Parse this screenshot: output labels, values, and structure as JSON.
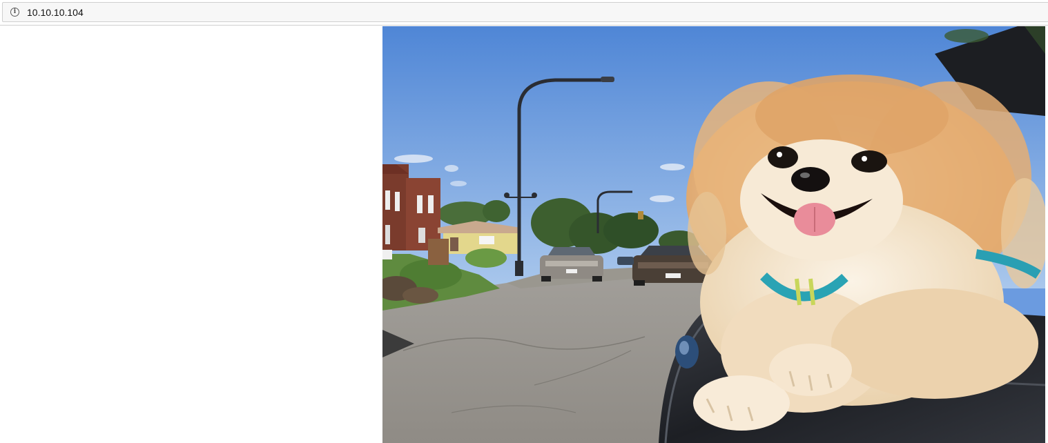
{
  "address_bar": {
    "url": "10.10.10.104",
    "info_icon": "info-circle-icon"
  },
  "page": {
    "image": {
      "subject": "dog-photo"
    }
  }
}
